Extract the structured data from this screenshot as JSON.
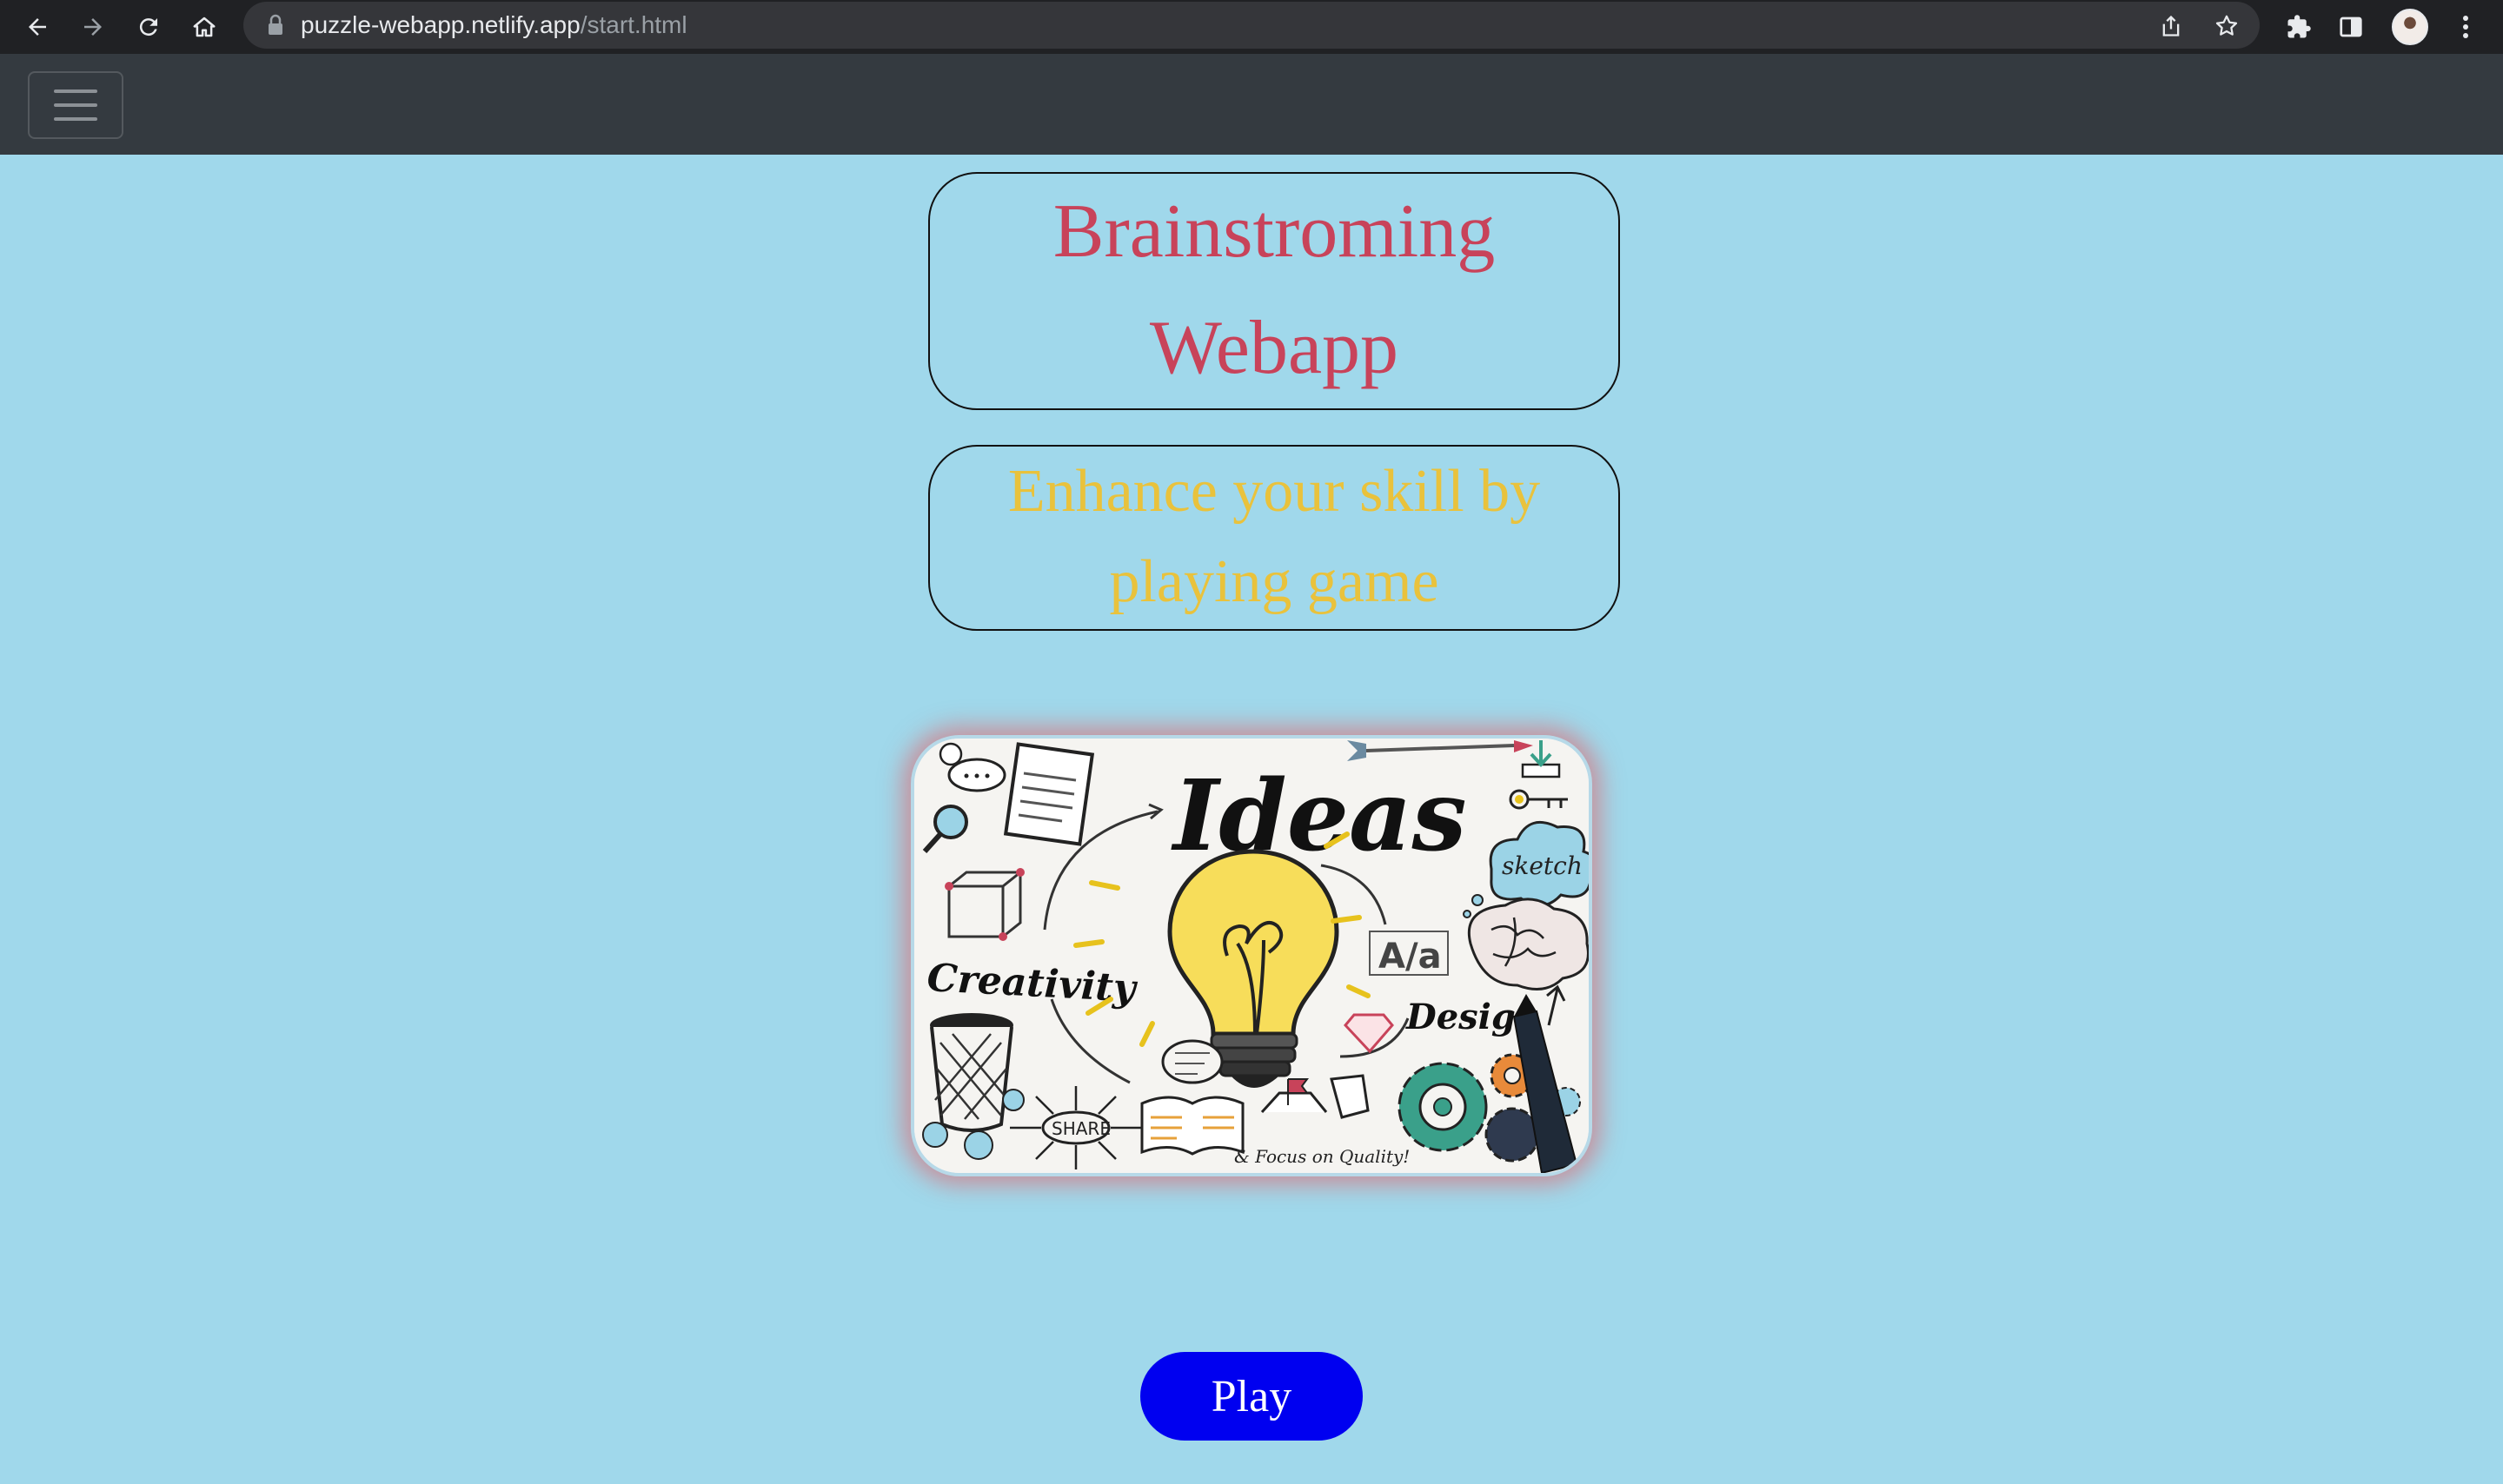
{
  "browser": {
    "url_domain": "puzzle-webapp.netlify.app",
    "url_path": "/start.html"
  },
  "navbar": {
    "menu_toggle": "hamburger-icon"
  },
  "header": {
    "title_line1": "Brainstroming",
    "title_line2": "Webapp",
    "subtitle_line1": "Enhance your skill by",
    "subtitle_line2": "playing game"
  },
  "hero_image": {
    "heading": "Ideas",
    "label_creativity": "Creativity",
    "label_design": "Design",
    "label_share": "SHARE",
    "label_sketch": "sketch",
    "label_aa": "A/a",
    "label_focus": "& Focus on Quality!"
  },
  "actions": {
    "play_label": "Play"
  },
  "colors": {
    "page_background": "#a0d8eb",
    "title": "#c8435a",
    "subtitle": "#e9c23c",
    "play_button": "#0000f0",
    "navbar": "#343a40"
  }
}
